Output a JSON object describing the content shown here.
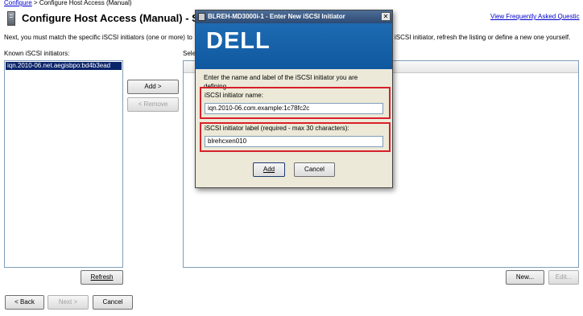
{
  "breadcrumb": {
    "parent": "Configure",
    "separator": ">",
    "current": "Configure Host Access (Manual)"
  },
  "page": {
    "title": "Configure Host Access (Manual) - Spe",
    "faq_link": "View Frequently Asked Questic",
    "instruction_left": "Next, you must match the specific iSCSI initiators (one or more) to",
    "instruction_right": "iSCSI initiator, refresh the listing or define a new one yourself."
  },
  "known_initiators": {
    "label": "Known iSCSI initiators:",
    "items": [
      "iqn.2010-06.net.aegisbpo:bd4b3ead"
    ]
  },
  "selected_initiators": {
    "label": "Selec"
  },
  "buttons": {
    "add": "Add >",
    "remove": "< Remove",
    "refresh": "Refresh",
    "new": "New...",
    "edit": "Edit...",
    "back": "< Back",
    "next": "Next >",
    "cancel": "Cancel"
  },
  "dialog": {
    "title": "BLREH-MD3000i-1 - Enter New iSCSI Initiator",
    "logo": "DELL",
    "prompt": "Enter the name and label of the iSCSI initiator you are defining.",
    "name_label": "iSCSI initiator name:",
    "name_value": "iqn.2010-06.com.example:1c78fc2c",
    "label_label": "iSCSI initiator label (required - max 30 characters):",
    "label_value": "blrehcxen010",
    "add_button": "Add",
    "cancel_button": "Cancel",
    "close_button": "✕"
  },
  "colors": {
    "dell_blue": "#1565b0",
    "highlight_red": "#d8202a",
    "selection": "#0a246a"
  }
}
